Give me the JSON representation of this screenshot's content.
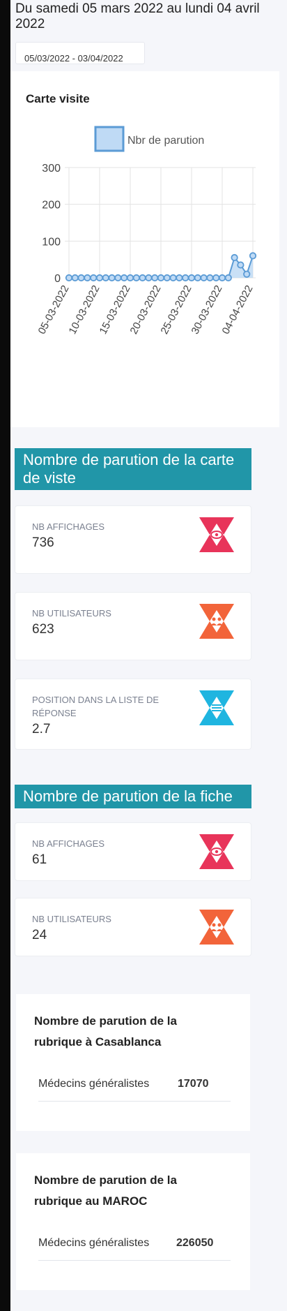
{
  "header": {
    "period_text": "Du samedi 05 mars 2022 au lundi 04 avril 2022",
    "date_range": "05/03/2022 - 03/04/2022"
  },
  "chart_card": {
    "title": "Carte visite"
  },
  "chart_data": {
    "type": "area",
    "title": "",
    "xlabel": "",
    "ylabel": "",
    "ylim": [
      0,
      300
    ],
    "yticks": [
      "0",
      "100",
      "200",
      "300"
    ],
    "x": [
      "05-03-2022",
      "06-03-2022",
      "07-03-2022",
      "08-03-2022",
      "09-03-2022",
      "10-03-2022",
      "11-03-2022",
      "12-03-2022",
      "13-03-2022",
      "14-03-2022",
      "15-03-2022",
      "16-03-2022",
      "17-03-2022",
      "18-03-2022",
      "19-03-2022",
      "20-03-2022",
      "21-03-2022",
      "22-03-2022",
      "23-03-2022",
      "24-03-2022",
      "25-03-2022",
      "26-03-2022",
      "27-03-2022",
      "28-03-2022",
      "29-03-2022",
      "30-03-2022",
      "31-03-2022",
      "01-04-2022",
      "02-04-2022",
      "03-04-2022",
      "04-04-2022"
    ],
    "xtick_labels": [
      "05-03-2022",
      "10-03-2022",
      "15-03-2022",
      "20-03-2022",
      "25-03-2022",
      "30-03-2022",
      "04-04-2022"
    ],
    "series": [
      {
        "name": "Nbr de parution",
        "values": [
          0,
          0,
          0,
          0,
          0,
          0,
          0,
          0,
          0,
          0,
          0,
          0,
          0,
          0,
          0,
          0,
          0,
          0,
          0,
          0,
          0,
          0,
          0,
          0,
          0,
          0,
          0,
          55,
          35,
          10,
          60
        ],
        "color": "#5b9bd5"
      }
    ],
    "grid": true,
    "legend": "top"
  },
  "sections": {
    "carte": {
      "title": "Nombre de parution de la carte de viste",
      "stats": [
        {
          "label": "NB AFFICHAGES",
          "value": "736",
          "icon": "eye-icon",
          "color": "#e8345a"
        },
        {
          "label": "NB UTILISATEURS",
          "value": "623",
          "icon": "users-icon",
          "color": "#f2643a"
        },
        {
          "label": "POSITION DANS LA LISTE DE RÉPONSE",
          "value": "2.7",
          "icon": "list-icon",
          "color": "#1fb5e0"
        }
      ]
    },
    "fiche": {
      "title": "Nombre de parution de la fiche",
      "stats": [
        {
          "label": "NB AFFICHAGES",
          "value": "61",
          "icon": "eye-icon",
          "color": "#e8345a"
        },
        {
          "label": "NB UTILISATEURS",
          "value": "24",
          "icon": "users-icon",
          "color": "#f2643a"
        }
      ]
    }
  },
  "rubriques": [
    {
      "title": "Nombre de parution de la rubrique à Casablanca",
      "row_name": "Médecins généralistes",
      "row_value": "17070"
    },
    {
      "title": "Nombre de parution de la rubrique au MAROC",
      "row_name": "Médecins généralistes",
      "row_value": "226050"
    }
  ]
}
